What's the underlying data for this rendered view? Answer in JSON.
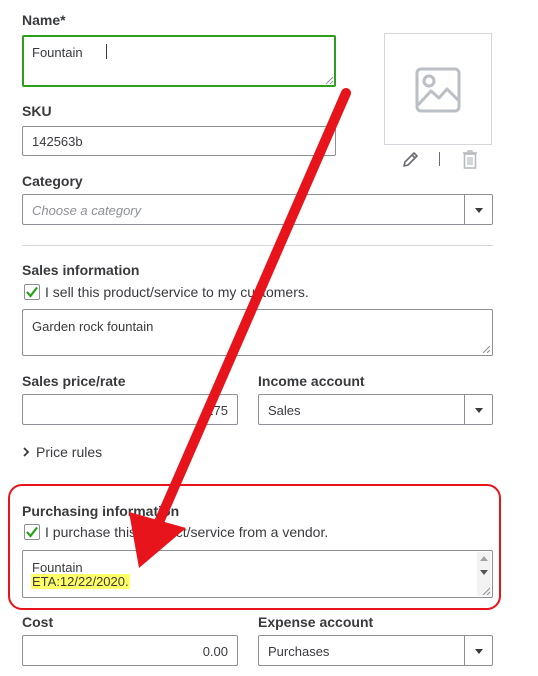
{
  "form": {
    "name_label": "Name*",
    "name_value": "Fountain",
    "sku_label": "SKU",
    "sku_value": "142563b",
    "category_label": "Category",
    "category_placeholder": "Choose a category",
    "sales_section_label": "Sales information",
    "sales_checkbox_label": "I sell this product/service to my customers.",
    "sales_checkbox_checked": true,
    "sales_description": "Garden rock fountain",
    "sales_price_label": "Sales price/rate",
    "sales_price_value": "275",
    "income_account_label": "Income account",
    "income_account_value": "Sales",
    "price_rules_label": "Price rules",
    "purchasing_section_label": "Purchasing information",
    "purchase_checkbox_label": "I purchase this product/service from a vendor.",
    "purchase_checkbox_checked": true,
    "purchase_description_line1": "Fountain",
    "purchase_description_line2": "ETA:12/22/2020.",
    "cost_label": "Cost",
    "cost_value": "0.00",
    "expense_account_label": "Expense account",
    "expense_account_value": "Purchases"
  },
  "image_panel": {
    "placeholder_icon": "image-placeholder-icon",
    "edit_icon": "pencil-icon",
    "delete_icon": "trash-icon"
  },
  "colors": {
    "focus_border": "#2ca01c",
    "checkmark": "#2ca01c",
    "annotation_red": "#e8141b",
    "highlight": "#ffff66"
  }
}
